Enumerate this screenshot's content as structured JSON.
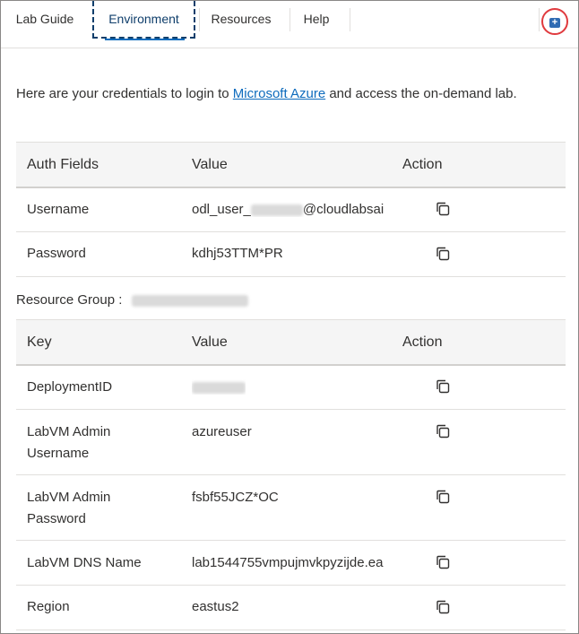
{
  "tabs": [
    {
      "label": "Lab Guide",
      "active": false
    },
    {
      "label": "Environment",
      "active": true
    },
    {
      "label": "Resources",
      "active": false
    },
    {
      "label": "Help",
      "active": false
    }
  ],
  "intro": {
    "before": "Here are your credentials to login to ",
    "link": "Microsoft Azure",
    "after": " and access the on-demand lab."
  },
  "credentials": {
    "headers": [
      "Auth Fields",
      "Value",
      "Action"
    ],
    "rows": [
      {
        "field": "Username",
        "value_prefix": "odl_user_",
        "value_suffix": "@cloudlabsai",
        "value": ""
      },
      {
        "field": "Password",
        "value": "kdhj53TTM*PR"
      }
    ]
  },
  "resource_group": {
    "label": "Resource Group :"
  },
  "environment": {
    "headers": [
      "Key",
      "Value",
      "Action"
    ],
    "rows": [
      {
        "key": "DeploymentID",
        "value": ""
      },
      {
        "key": "LabVM Admin Username",
        "value": "azureuser"
      },
      {
        "key": "LabVM Admin Password",
        "value": "fsbf55JCZ*OC"
      },
      {
        "key": "LabVM DNS Name",
        "value": "lab1544755vmpujmvkpyzijde.ea"
      },
      {
        "key": "Region",
        "value": "eastus2"
      }
    ]
  },
  "icons": {
    "copy": "copy-icon",
    "expand": "expand-icon"
  },
  "colors": {
    "link": "#0f6cbd",
    "active_tab": "#0f3e6b",
    "highlight_circle": "#e03a3e"
  }
}
